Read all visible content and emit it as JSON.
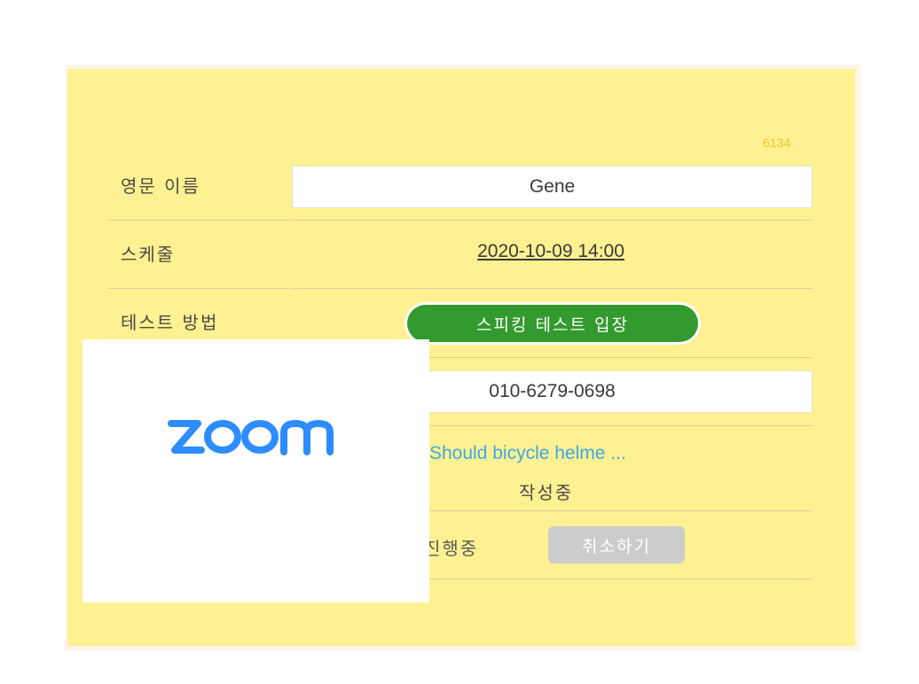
{
  "card": {
    "code": "6134",
    "rows": {
      "english_name": {
        "label": "영문 이름",
        "value": "Gene"
      },
      "schedule": {
        "label": "스케줄",
        "value": "2020-10-09 14:00"
      },
      "test_method": {
        "label": "테스트 방법",
        "button_label": "스피킹 테스트 입장"
      },
      "phone": {
        "value": "010-6279-0698"
      },
      "essay": {
        "link": "Should bicycle helme ...",
        "status": "작성중"
      },
      "state": {
        "status": "진행중",
        "cancel_label": "취소하기"
      }
    }
  },
  "overlay": {
    "logo_text": "zoom",
    "logo_color": "#2d8cff"
  },
  "colors": {
    "card_bg": "#fef191",
    "accent_green": "#339a2e",
    "link_blue": "#3fa8e6"
  }
}
